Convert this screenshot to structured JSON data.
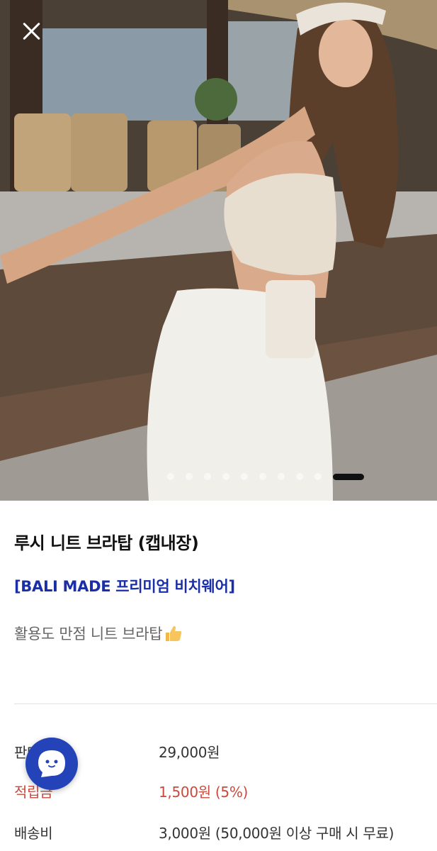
{
  "product": {
    "title": "루시 니트 브라탑 (캡내장)",
    "subtitle": "[BALI MADE 프리미엄 비치웨어]",
    "description": "활용도 만점 니트 브라탑"
  },
  "carousel": {
    "total_slides": 10,
    "active_index": 9
  },
  "details": {
    "price_label": "판매가",
    "price_value": "29,000원",
    "points_label": "적립금",
    "points_value": "1,500원 (5%)",
    "shipping_label": "배송비",
    "shipping_value": "3,000원 (50,000원 이상 구매 시 무료)"
  },
  "colors": {
    "accent_blue": "#1a2ea8",
    "points_red": "#c94a3c",
    "chat_button": "#2443b8"
  },
  "icons": {
    "close": "close-icon",
    "thumbs_up": "thumbs-up-icon",
    "chat": "chat-bubble-icon"
  }
}
